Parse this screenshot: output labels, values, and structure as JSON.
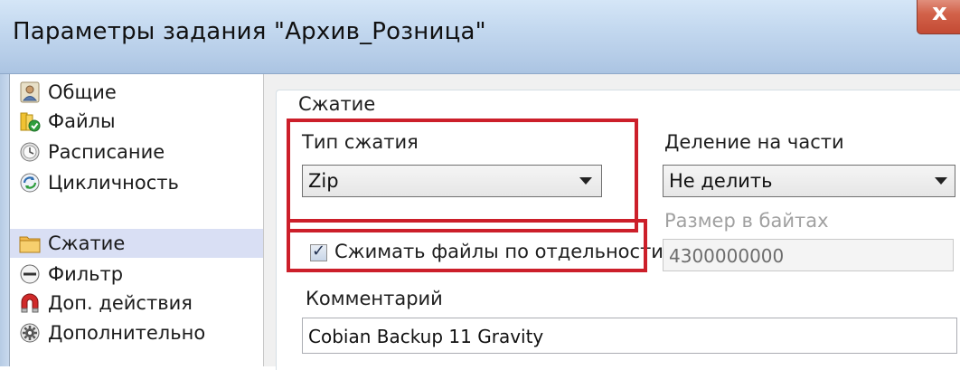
{
  "window": {
    "title": "Параметры задания \"Архив_Розница\"",
    "close_glyph": "x"
  },
  "nav": {
    "items": [
      {
        "label": "Общие",
        "icon": "user-icon",
        "selected": false
      },
      {
        "label": "Файлы",
        "icon": "files-icon",
        "selected": false
      },
      {
        "label": "Расписание",
        "icon": "clock-icon",
        "selected": false
      },
      {
        "label": "Цикличность",
        "icon": "cycle-icon",
        "selected": false
      },
      {
        "label": "Сжатие",
        "icon": "folder-icon",
        "selected": true
      },
      {
        "label": "Фильтр",
        "icon": "filter-icon",
        "selected": false
      },
      {
        "label": "Доп. действия",
        "icon": "magnet-icon",
        "selected": false
      },
      {
        "label": "Дополнительно",
        "icon": "gear-icon",
        "selected": false
      }
    ]
  },
  "compression": {
    "group_title": "Сжатие",
    "type_label": "Тип сжатия",
    "type_value": "Zip",
    "split_label": "Деление на части",
    "split_value": "Не делить",
    "size_label": "Размер в байтах",
    "size_value": "4300000000",
    "separate_label": "Сжимать файлы по отдельности",
    "separate_checked": true,
    "comment_label": "Комментарий",
    "comment_value": "Cobian Backup 11 Gravity"
  },
  "colors": {
    "highlight_box": "#cc1f2a",
    "selected_nav": "#d9dff4"
  }
}
